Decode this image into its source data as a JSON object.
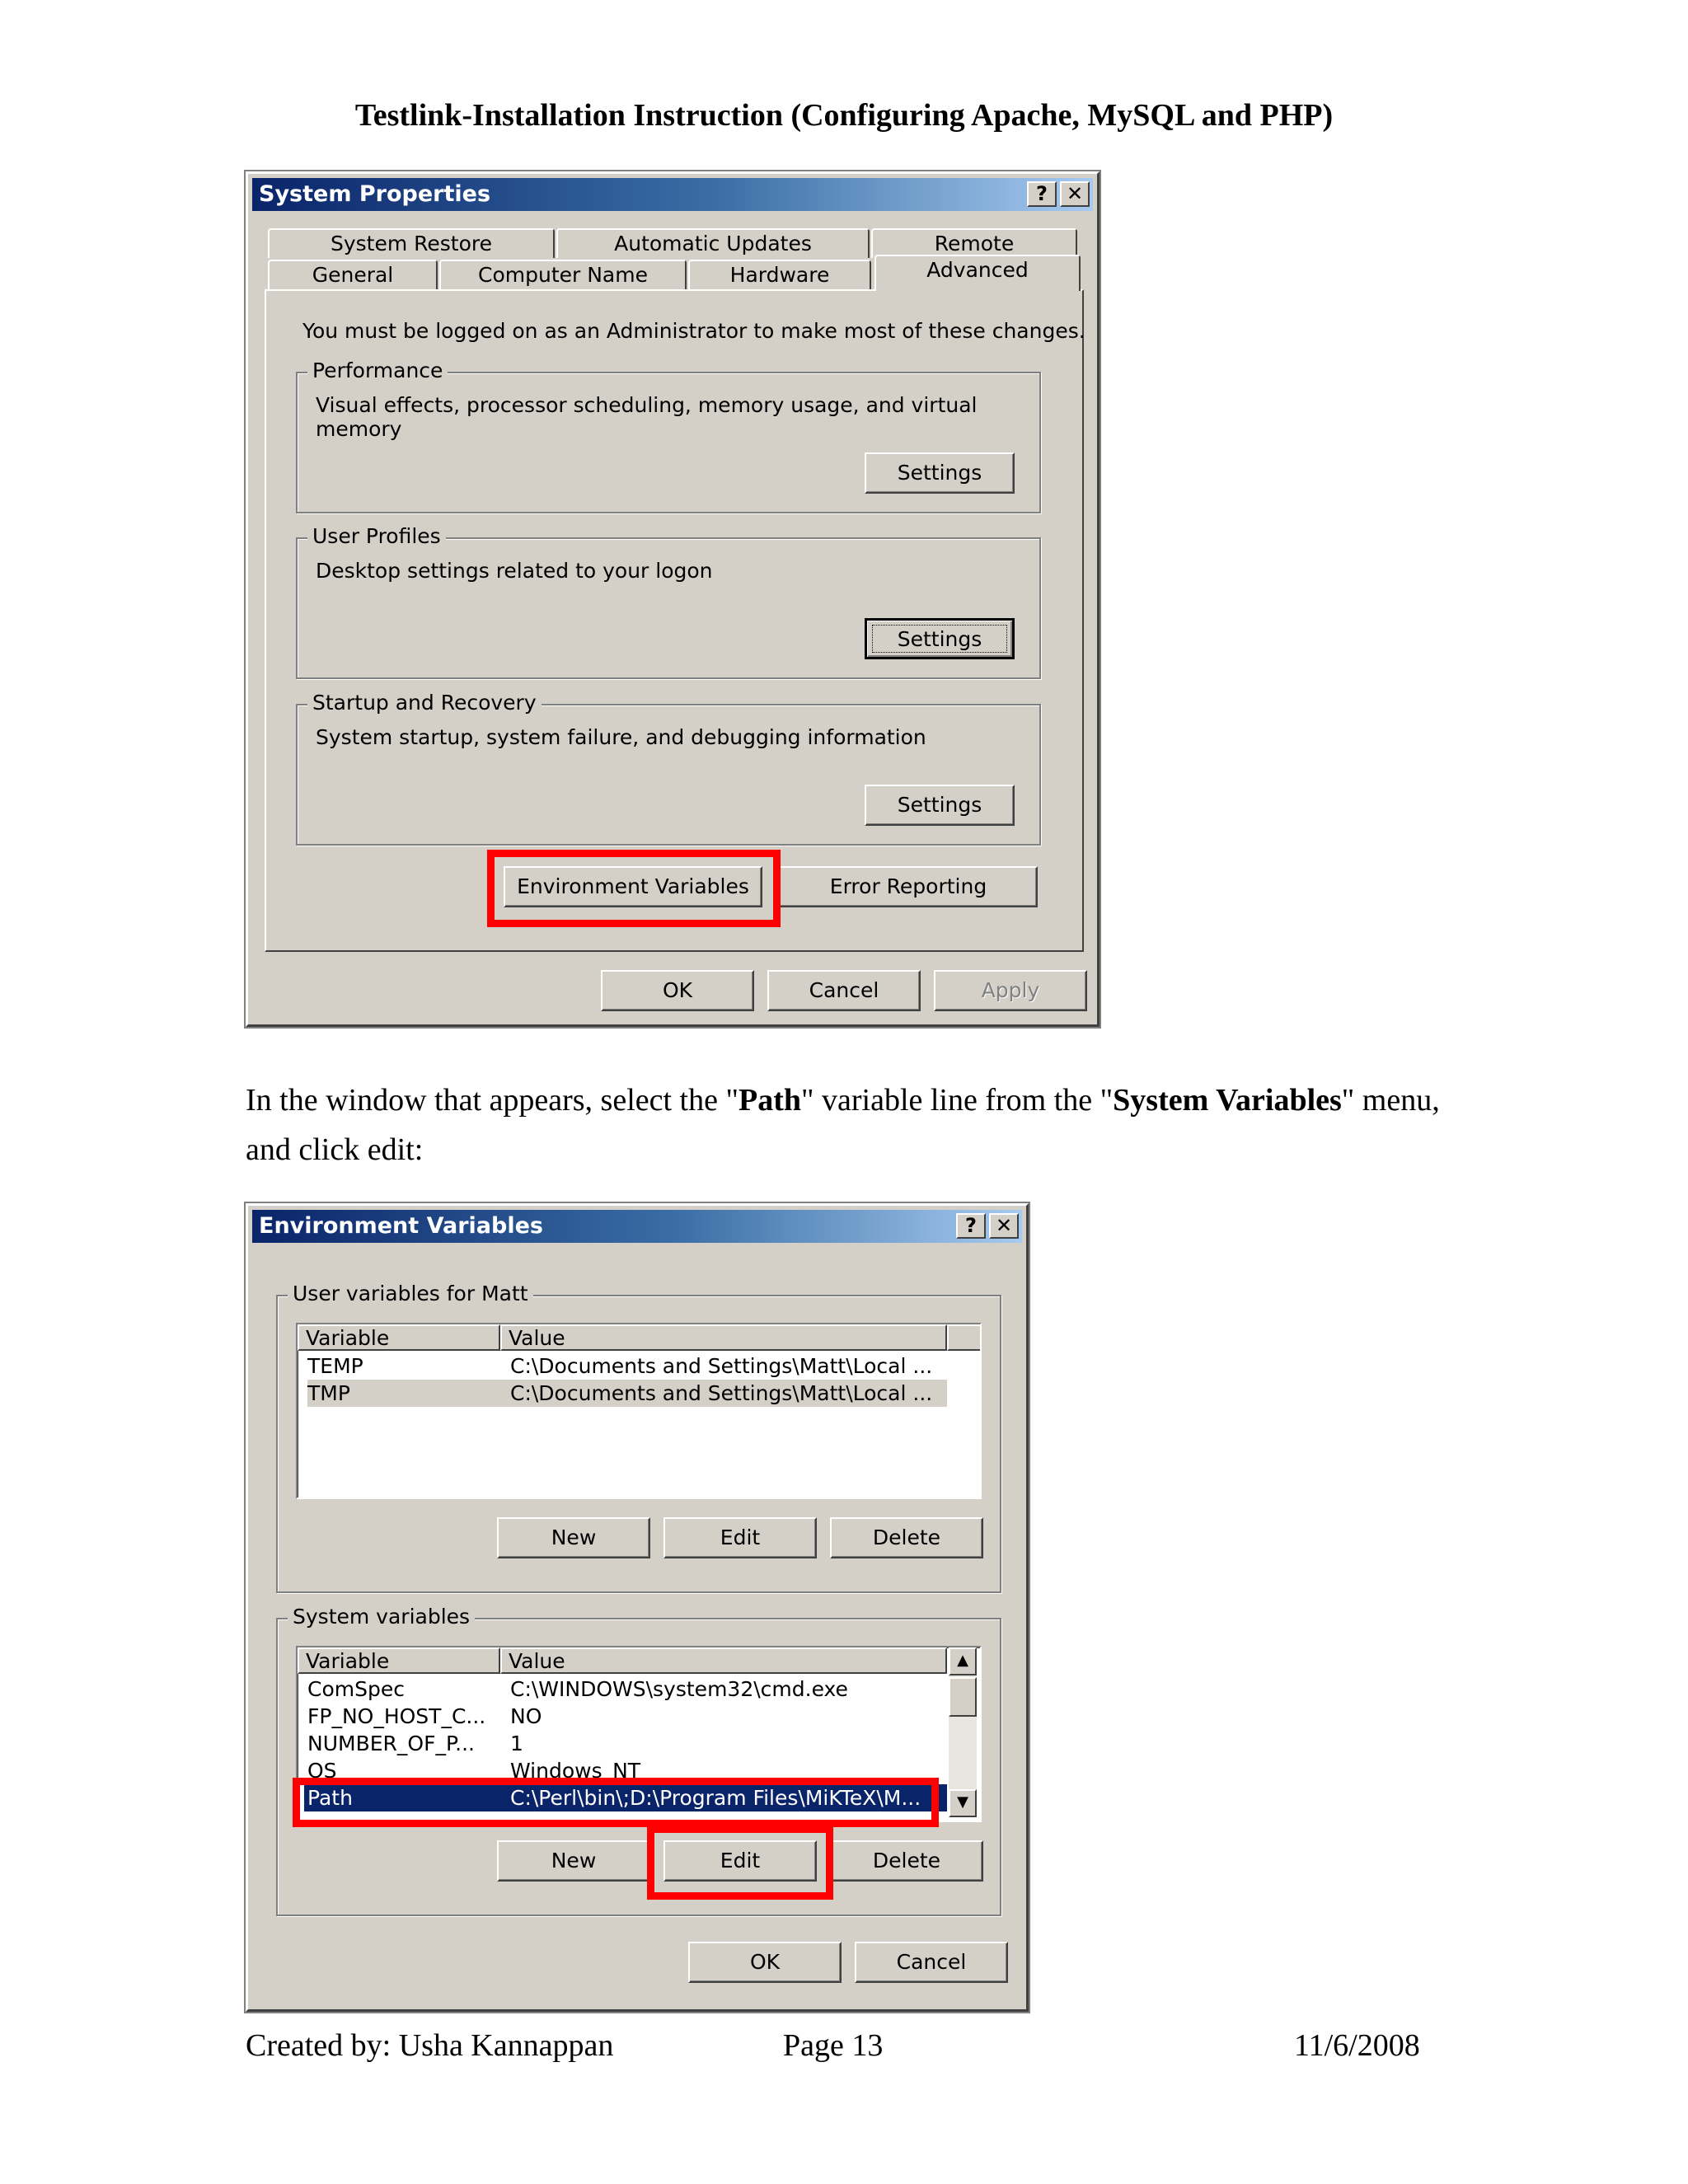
{
  "page": {
    "title": "Testlink-Installation Instruction (Configuring Apache, MySQL and PHP)",
    "para_1": "In the window that appears, select the \"",
    "para_bold_1": "Path",
    "para_2": "\" variable line from the \"",
    "para_bold_2": "System Variables",
    "para_3": "\" menu, and click edit:",
    "footer": {
      "author": "Created by: Usha Kannappan",
      "page": "Page 13",
      "date": "11/6/2008"
    }
  },
  "system_properties": {
    "title": "System Properties",
    "help_btn": "?",
    "close_btn": "✕",
    "tabs_row1": [
      "System Restore",
      "Automatic Updates",
      "Remote"
    ],
    "tabs_row2": [
      "General",
      "Computer Name",
      "Hardware",
      "Advanced"
    ],
    "admin_note": "You must be logged on as an Administrator to make most of these changes.",
    "performance": {
      "label": "Performance",
      "desc": "Visual effects, processor scheduling, memory usage, and virtual memory",
      "button": "Settings"
    },
    "user_profiles": {
      "label": "User Profiles",
      "desc": "Desktop settings related to your logon",
      "button": "Settings"
    },
    "startup": {
      "label": "Startup and Recovery",
      "desc": "System startup, system failure, and debugging information",
      "button": "Settings"
    },
    "env_button": "Environment Variables",
    "error_button": "Error Reporting",
    "ok": "OK",
    "cancel": "Cancel",
    "apply": "Apply",
    "highlight_color": "#ff0000"
  },
  "environment_variables": {
    "title": "Environment Variables",
    "help_btn": "?",
    "close_btn": "✕",
    "user_group_label": "User variables for Matt",
    "col_variable": "Variable",
    "col_value": "Value",
    "user_rows": [
      {
        "variable": "TEMP",
        "value": "C:\\Documents and Settings\\Matt\\Local ..."
      },
      {
        "variable": "TMP",
        "value": "C:\\Documents and Settings\\Matt\\Local ..."
      }
    ],
    "user_new": "New",
    "user_edit": "Edit",
    "user_delete": "Delete",
    "system_group_label": "System variables",
    "system_rows": [
      {
        "variable": "ComSpec",
        "value": "C:\\WINDOWS\\system32\\cmd.exe"
      },
      {
        "variable": "FP_NO_HOST_C...",
        "value": "NO"
      },
      {
        "variable": "NUMBER_OF_P...",
        "value": "1"
      },
      {
        "variable": "OS",
        "value": "Windows_NT"
      },
      {
        "variable": "Path",
        "value": "C:\\Perl\\bin\\;D:\\Program Files\\MiKTeX\\M..."
      }
    ],
    "sys_new": "New",
    "sys_edit": "Edit",
    "sys_delete": "Delete",
    "ok": "OK",
    "cancel": "Cancel"
  }
}
